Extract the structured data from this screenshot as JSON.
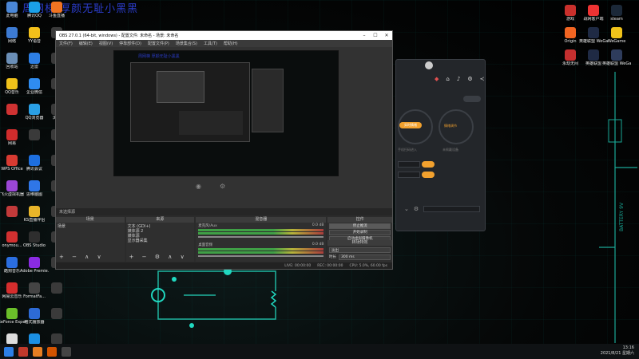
{
  "banner": "周网梯   厚颜无耻小黑黑",
  "desktop_left": [
    {
      "label": "此电脑",
      "color": "#4a87d6"
    },
    {
      "label": "腾讯QQ",
      "color": "#1aa0e8"
    },
    {
      "label": "斗鱼直播",
      "color": "#f07422"
    },
    {
      "label": "网络",
      "color": "#3d7bd3"
    },
    {
      "label": "YY语音",
      "color": "#f3c01a"
    },
    {
      "label": "",
      "color": "#3a3a3a"
    },
    {
      "label": "回收站",
      "color": "#6b8fb7"
    },
    {
      "label": "迅雷",
      "color": "#2d7fe6"
    },
    {
      "label": "",
      "color": "#3a3a3a"
    },
    {
      "label": "QQ音乐",
      "color": "#f0c21a"
    },
    {
      "label": "企业微信",
      "color": "#2f8cf0"
    },
    {
      "label": "",
      "color": "#3a3a3a"
    },
    {
      "label": "",
      "color": "#d03232"
    },
    {
      "label": "QQ浏览器",
      "color": "#2aa0e6"
    },
    {
      "label": "浏览",
      "color": "#3a3a3a"
    },
    {
      "label": "网易",
      "color": "#d02c2c"
    },
    {
      "label": "",
      "color": "#3a3a3a"
    },
    {
      "label": "",
      "color": "#3a3a3a"
    },
    {
      "label": "WPS Office",
      "color": "#d83b32"
    },
    {
      "label": "腾讯会议",
      "color": "#1d6fe0"
    },
    {
      "label": "",
      "color": "#3a3a3a"
    },
    {
      "label": "飞火虚拟机器",
      "color": "#9b46d6"
    },
    {
      "label": "思维脑图",
      "color": "#2f76e8"
    },
    {
      "label": "",
      "color": "#3a3a3a"
    },
    {
      "label": "",
      "color": "#c23a3a"
    },
    {
      "label": "KS直播伴侣",
      "color": "#e8b52a"
    },
    {
      "label": "",
      "color": "#3a3a3a"
    },
    {
      "label": "onymou...",
      "color": "#d23030"
    },
    {
      "label": "OBS Studio",
      "color": "#2e2e2e"
    },
    {
      "label": "",
      "color": "#3a3a3a"
    },
    {
      "label": "酷狗音乐",
      "color": "#2b6ee0"
    },
    {
      "label": "Adobe Premie...",
      "color": "#8a2be2"
    },
    {
      "label": "",
      "color": "#3a3a3a"
    },
    {
      "label": "网易云音乐",
      "color": "#d52d2d"
    },
    {
      "label": "FormatFa...",
      "color": "#444"
    },
    {
      "label": "",
      "color": "#3a3a3a"
    },
    {
      "label": "GeForce Experience",
      "color": "#6abf2a"
    },
    {
      "label": "格式播放器",
      "color": "#2d6bd6"
    },
    {
      "label": "",
      "color": "#3a3a3a"
    },
    {
      "label": "Bongo Cat Mver.exe",
      "color": "#ddd"
    },
    {
      "label": "QQ游戏",
      "color": "#1b8fe3"
    },
    {
      "label": "",
      "color": "#3a3a3a"
    }
  ],
  "desktop_right": [
    {
      "label": "游戏",
      "color": "#c9302c"
    },
    {
      "label": "战网客户端",
      "color": "#e33"
    },
    {
      "label": "steam",
      "color": "#1b2838"
    },
    {
      "label": "Origin",
      "color": "#f26522"
    },
    {
      "label": "英雄联盟 WeGame版",
      "color": "#1f2a44"
    },
    {
      "label": "WeGame",
      "color": "#f0c21a"
    },
    {
      "label": "永劫无间",
      "color": "#c42f2f"
    },
    {
      "label": "英雄联盟",
      "color": "#1f2a44"
    },
    {
      "label": "英雄联盟 WeGame版",
      "color": "#2e3c5c"
    }
  ],
  "obs": {
    "title": "OBS 27.0.1 (64-bit, windows) - 配置文件: 未命名 - 场景: 未命名",
    "menu": [
      "文件(F)",
      "编辑(E)",
      "视图(V)",
      "停靠部件(D)",
      "配置文件(P)",
      "场景集合(S)",
      "工具(T)",
      "帮助(H)"
    ],
    "scene_bar": "未选择源",
    "panels": {
      "scenes": {
        "title": "场景",
        "items": [
          "场景"
        ]
      },
      "sources": {
        "title": "来源",
        "items": [
          "文本 (GDI+)",
          "媒体源 2",
          "媒体源",
          "显示器采集"
        ]
      },
      "mixer": {
        "title": "混音器",
        "tracks": [
          {
            "name": "麦克风/Aux",
            "db": "0.0 dB"
          },
          {
            "name": "桌面音频",
            "db": "0.0 dB"
          }
        ]
      },
      "transitions": {
        "title": "转场特效",
        "type": "淡出",
        "duration_label": "时长",
        "duration": "300 ms"
      },
      "controls": {
        "title": "控件",
        "buttons": [
          "停止推流",
          "开始录制",
          "启动虚拟摄像机",
          "工作室模式",
          "设置",
          "退出"
        ]
      }
    },
    "status": [
      "LIVE: 00:00:00",
      "REC: 00:00:00",
      "CPU: 5.0%, 60.00 fps"
    ]
  },
  "app_panel": {
    "left_circle": "实时情绪",
    "right_circle": "情绪调节",
    "left_caption": "手机扫码进入",
    "right_caption": "未佩戴设备"
  },
  "clock": {
    "time": "13:16",
    "date": "2021/8/21 星期六"
  }
}
